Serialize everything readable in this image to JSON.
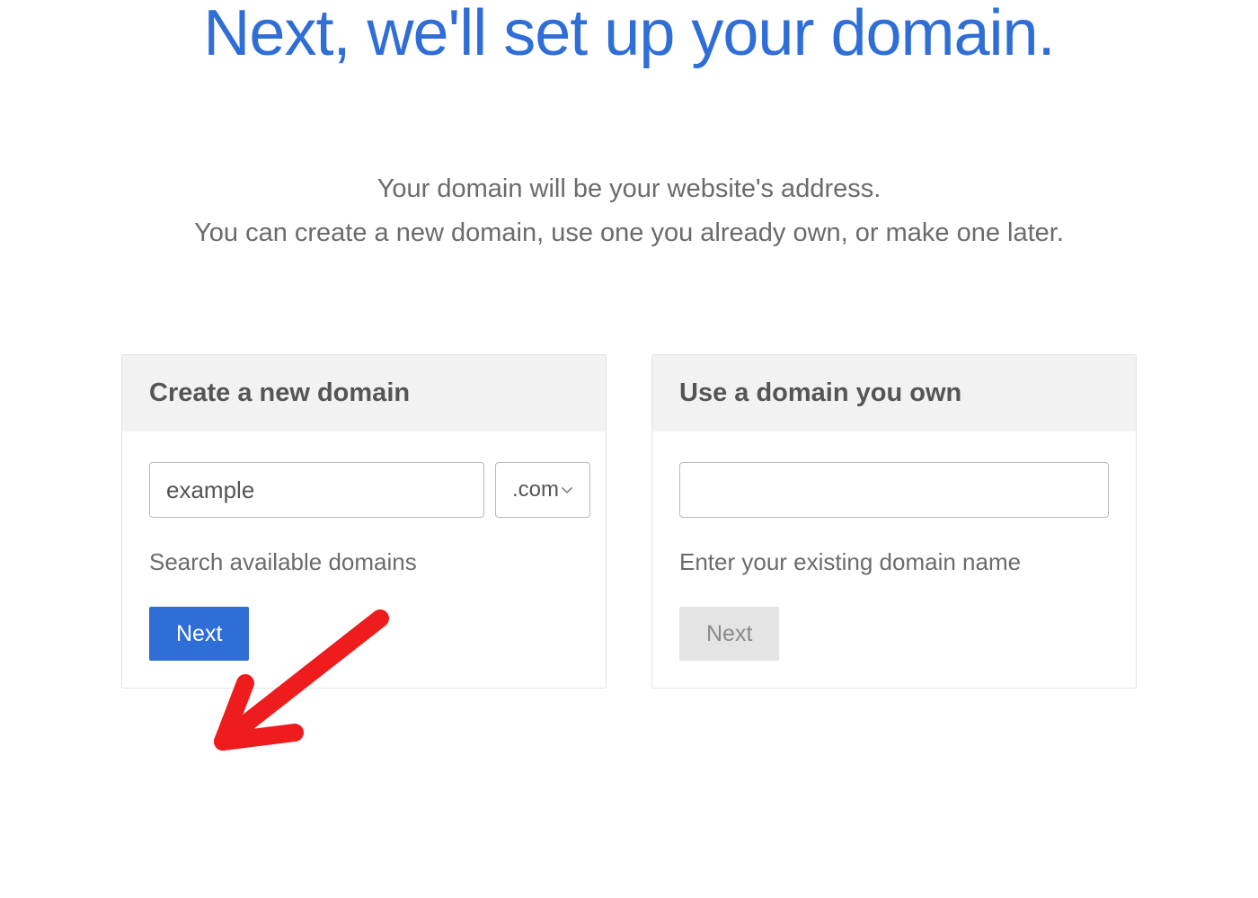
{
  "page": {
    "title": "Next, we'll set up your domain.",
    "subtext_line1": "Your domain will be your website's address.",
    "subtext_line2": "You can create a new domain, use one you already own, or make one later."
  },
  "create_card": {
    "header": "Create a new domain",
    "domain_value": "example",
    "tld_selected": ".com",
    "helper": "Search available domains",
    "next_label": "Next"
  },
  "own_card": {
    "header": "Use a domain you own",
    "domain_value": "",
    "helper": "Enter your existing domain name",
    "next_label": "Next"
  },
  "colors": {
    "accent": "#2f6ed6",
    "annotation": "#ee1c1c"
  }
}
